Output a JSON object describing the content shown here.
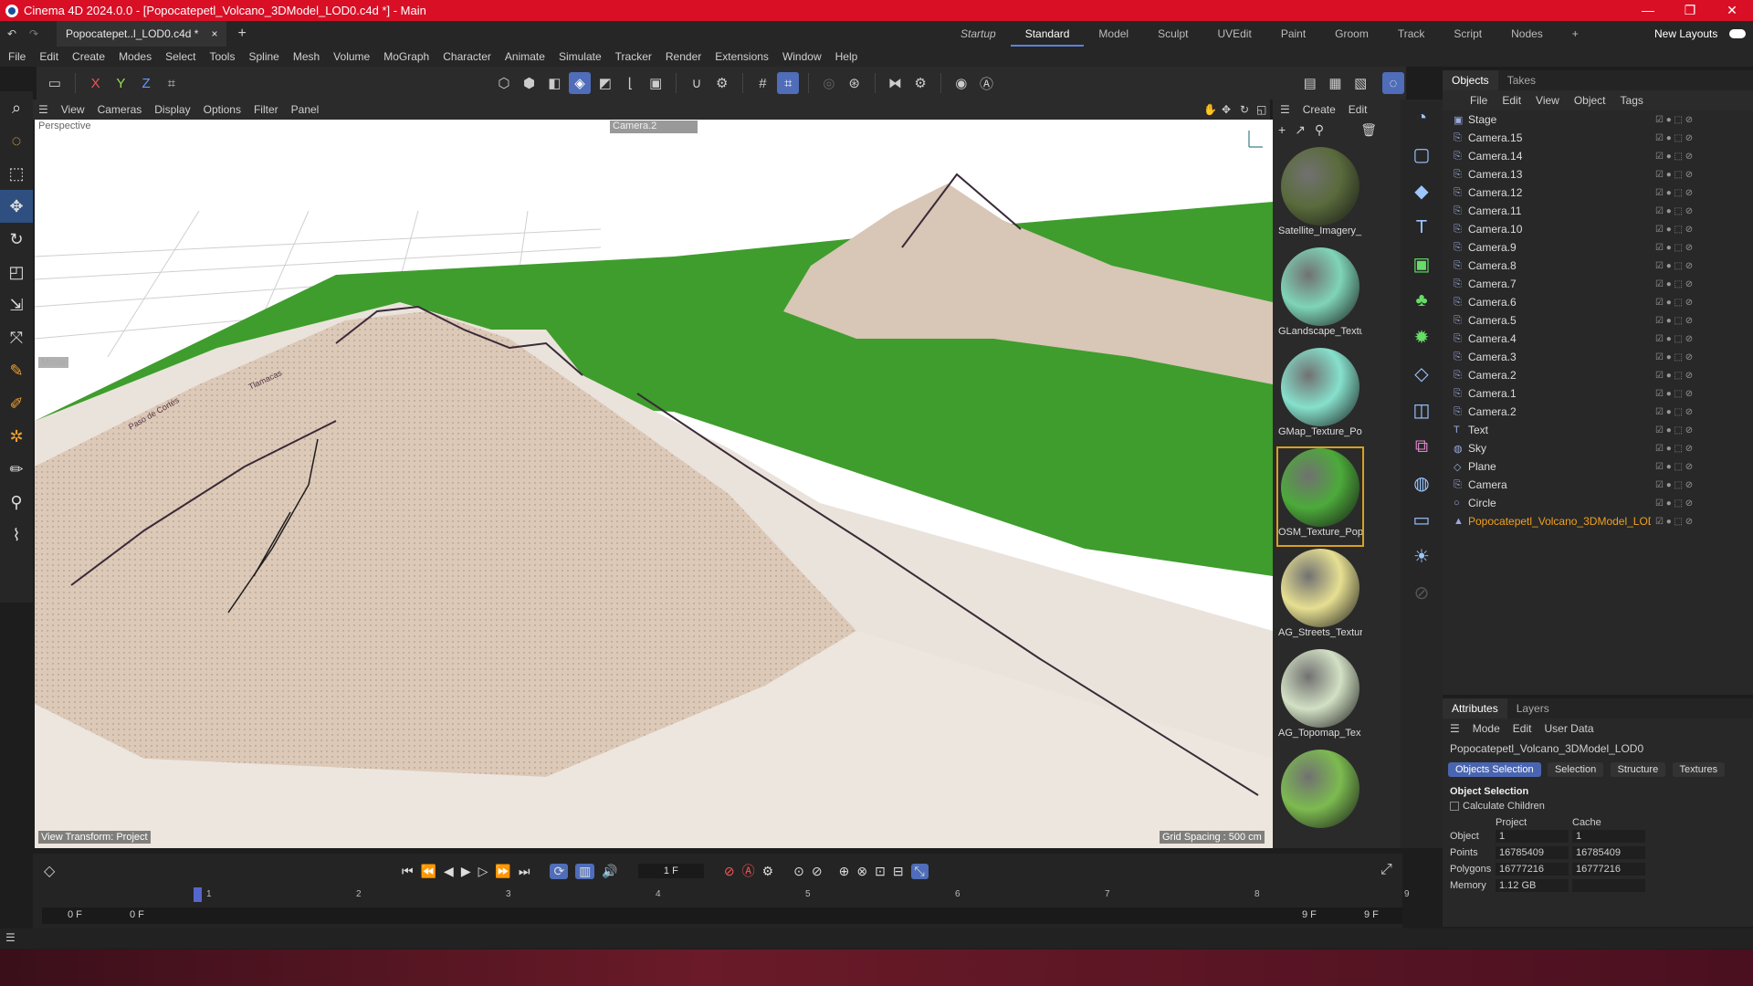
{
  "window": {
    "title": "Cinema 4D 2024.0.0 - [Popocatepetl_Volcano_3DModel_LOD0.c4d *] - Main",
    "controls": [
      "—",
      "❐",
      "✕"
    ]
  },
  "doc_tab": {
    "label": "Popocatepet..l_LOD0.c4d *",
    "close": "×",
    "add": "+"
  },
  "layouts": [
    "Startup",
    "Standard",
    "Model",
    "Sculpt",
    "UVEdit",
    "Paint",
    "Groom",
    "Track",
    "Script",
    "Nodes"
  ],
  "new_layouts": "New Layouts",
  "menu": [
    "File",
    "Edit",
    "Create",
    "Modes",
    "Select",
    "Tools",
    "Spline",
    "Mesh",
    "Volume",
    "MoGraph",
    "Character",
    "Animate",
    "Simulate",
    "Tracker",
    "Render",
    "Extensions",
    "Window",
    "Help"
  ],
  "axis_toggles": [
    "X",
    "Y",
    "Z"
  ],
  "viewport": {
    "menu": [
      "View",
      "Cameras",
      "Display",
      "Options",
      "Filter",
      "Panel"
    ],
    "name": "Perspective",
    "camera": "Camera.2",
    "tool_hint": "Move",
    "view_transform": "View Transform: Project",
    "grid_spacing": "Grid Spacing : 500 cm",
    "map_labels": [
      "Paso de Cortés",
      "Tlamacas"
    ]
  },
  "material_panel": {
    "menu": [
      "Create",
      "Edit"
    ],
    "materials": [
      {
        "name": "Satellite_Imagery_",
        "color": "#5a6b3c"
      },
      {
        "name": "GLandscape_Textu",
        "color": "#7fd4b8"
      },
      {
        "name": "GMap_Texture_Po",
        "color": "#86e0cc"
      },
      {
        "name": "OSM_Texture_Pop",
        "color": "#4caa3a"
      },
      {
        "name": "AG_Streets_Textur",
        "color": "#e6df92"
      },
      {
        "name": "AG_Topomap_Tex",
        "color": "#d2e0c4"
      },
      {
        "name": "",
        "color": "#7cbb50"
      }
    ]
  },
  "objects_panel": {
    "tabs": [
      "Objects",
      "Takes"
    ],
    "menu": [
      "File",
      "Edit",
      "View",
      "Object",
      "Tags"
    ],
    "objects": [
      {
        "name": "Stage",
        "icon": "stage-icon"
      },
      {
        "name": "Camera.15",
        "icon": "camera-icon"
      },
      {
        "name": "Camera.14",
        "icon": "camera-icon"
      },
      {
        "name": "Camera.13",
        "icon": "camera-icon"
      },
      {
        "name": "Camera.12",
        "icon": "camera-icon"
      },
      {
        "name": "Camera.11",
        "icon": "camera-icon"
      },
      {
        "name": "Camera.10",
        "icon": "camera-icon"
      },
      {
        "name": "Camera.9",
        "icon": "camera-icon"
      },
      {
        "name": "Camera.8",
        "icon": "camera-icon"
      },
      {
        "name": "Camera.7",
        "icon": "camera-icon"
      },
      {
        "name": "Camera.6",
        "icon": "camera-icon"
      },
      {
        "name": "Camera.5",
        "icon": "camera-icon"
      },
      {
        "name": "Camera.4",
        "icon": "camera-icon"
      },
      {
        "name": "Camera.3",
        "icon": "camera-icon"
      },
      {
        "name": "Camera.2",
        "icon": "camera-icon"
      },
      {
        "name": "Camera.1",
        "icon": "camera-icon"
      },
      {
        "name": "Camera.2",
        "icon": "camera-icon"
      },
      {
        "name": "Text",
        "icon": "text-icon"
      },
      {
        "name": "Sky",
        "icon": "sky-icon"
      },
      {
        "name": "Plane",
        "icon": "plane-icon"
      },
      {
        "name": "Camera",
        "icon": "camera-icon"
      },
      {
        "name": "Circle",
        "icon": "circle-icon"
      },
      {
        "name": "Popocatepetl_Volcano_3DModel_LOD0",
        "icon": "polygon-object-icon"
      }
    ]
  },
  "attributes": {
    "tabs": [
      "Attributes",
      "Layers"
    ],
    "menu": [
      "Mode",
      "Edit",
      "User Data"
    ],
    "object_name": "Popocatepetl_Volcano_3DModel_LOD0",
    "buttons": [
      "Objects Selection",
      "Selection",
      "Structure",
      "Textures"
    ],
    "section": "Object Selection",
    "checkbox": "Calculate Children",
    "col_headers": [
      "Project",
      "Cache"
    ],
    "rows": [
      {
        "label": "Object",
        "project": "1",
        "cache": "1"
      },
      {
        "label": "Points",
        "project": "16785409",
        "cache": "16785409"
      },
      {
        "label": "Polygons",
        "project": "16777216",
        "cache": "16777216"
      },
      {
        "label": "Memory",
        "project": "1.12 GB",
        "cache": ""
      }
    ]
  },
  "timeline": {
    "current_frame": "1 F",
    "ruler": [
      "1",
      "2",
      "3",
      "4",
      "5",
      "6",
      "7",
      "8",
      "9"
    ],
    "start": "0 F",
    "start2": "0 F",
    "end": "9 F",
    "end2": "9 F"
  },
  "colors": {
    "accent": "#4f6db8",
    "titlebar": "#d90f26",
    "highlight": "#f0a020"
  }
}
